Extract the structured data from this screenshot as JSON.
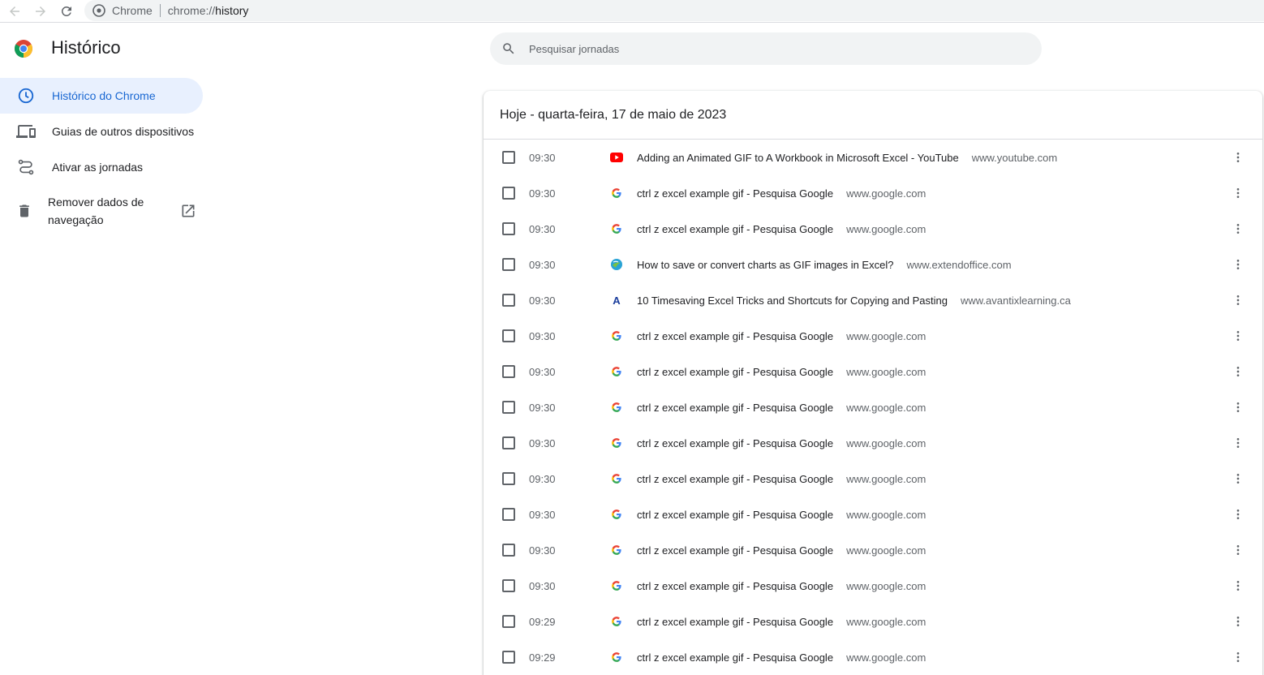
{
  "browser": {
    "site_name": "Chrome",
    "url_scheme": "chrome://",
    "url_path": "history"
  },
  "header": {
    "title": "Histórico",
    "search_placeholder": "Pesquisar jornadas"
  },
  "sidebar": {
    "items": [
      {
        "label": "Histórico do Chrome",
        "icon": "clock-icon",
        "active": true
      },
      {
        "label": "Guias de outros dispositivos",
        "icon": "devices-icon",
        "active": false
      },
      {
        "label": "Ativar as jornadas",
        "icon": "journeys-icon",
        "active": false
      }
    ],
    "remove_data": {
      "label_line1": "Remover dados de",
      "label_line2": "navegação",
      "icon": "trash-icon",
      "external_icon": "open-in-new-icon"
    }
  },
  "main": {
    "date_header": "Hoje - quarta-feira, 17 de maio de 2023",
    "rows": [
      {
        "time": "09:30",
        "favicon": "youtube",
        "title": "Adding an Animated GIF to A Workbook in Microsoft Excel - YouTube",
        "domain": "www.youtube.com"
      },
      {
        "time": "09:30",
        "favicon": "google",
        "title": "ctrl z excel example gif - Pesquisa Google",
        "domain": "www.google.com"
      },
      {
        "time": "09:30",
        "favicon": "google",
        "title": "ctrl z excel example gif - Pesquisa Google",
        "domain": "www.google.com"
      },
      {
        "time": "09:30",
        "favicon": "extendoffice",
        "title": "How to save or convert charts as GIF images in Excel?",
        "domain": "www.extendoffice.com"
      },
      {
        "time": "09:30",
        "favicon": "avantix",
        "title": "10 Timesaving Excel Tricks and Shortcuts for Copying and Pasting",
        "domain": "www.avantixlearning.ca"
      },
      {
        "time": "09:30",
        "favicon": "google",
        "title": "ctrl z excel example gif - Pesquisa Google",
        "domain": "www.google.com"
      },
      {
        "time": "09:30",
        "favicon": "google",
        "title": "ctrl z excel example gif - Pesquisa Google",
        "domain": "www.google.com"
      },
      {
        "time": "09:30",
        "favicon": "google",
        "title": "ctrl z excel example gif - Pesquisa Google",
        "domain": "www.google.com"
      },
      {
        "time": "09:30",
        "favicon": "google",
        "title": "ctrl z excel example gif - Pesquisa Google",
        "domain": "www.google.com"
      },
      {
        "time": "09:30",
        "favicon": "google",
        "title": "ctrl z excel example gif - Pesquisa Google",
        "domain": "www.google.com"
      },
      {
        "time": "09:30",
        "favicon": "google",
        "title": "ctrl z excel example gif - Pesquisa Google",
        "domain": "www.google.com"
      },
      {
        "time": "09:30",
        "favicon": "google",
        "title": "ctrl z excel example gif - Pesquisa Google",
        "domain": "www.google.com"
      },
      {
        "time": "09:30",
        "favicon": "google",
        "title": "ctrl z excel example gif - Pesquisa Google",
        "domain": "www.google.com"
      },
      {
        "time": "09:29",
        "favicon": "google",
        "title": "ctrl z excel example gif - Pesquisa Google",
        "domain": "www.google.com"
      },
      {
        "time": "09:29",
        "favicon": "google",
        "title": "ctrl z excel example gif - Pesquisa Google",
        "domain": "www.google.com"
      }
    ]
  },
  "colors": {
    "accent": "#1967d2",
    "active_bg": "#e8f0fe"
  }
}
